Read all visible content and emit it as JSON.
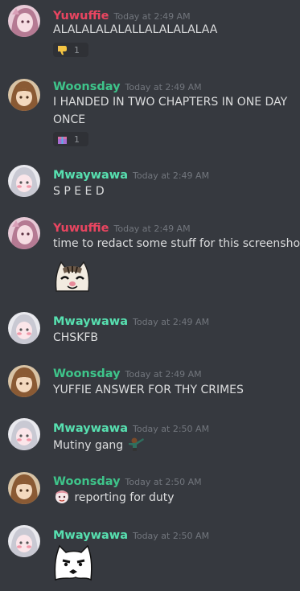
{
  "colors": {
    "background": "#36393f",
    "timestamp": "#72767d",
    "text": "#dcddde",
    "yuwuffie": "#e94560",
    "woonsday": "#3ec48a",
    "mwaywawa": "#57e0b0"
  },
  "messages": [
    {
      "author": "Yuwuffie",
      "timestamp": "Today at 2:49 AM",
      "lines": [
        "ALALALALALALLALALALALAA"
      ],
      "reaction": {
        "icon": "thumbs-down-icon",
        "count": "1"
      }
    },
    {
      "author": "Woonsday",
      "timestamp": "Today at 2:49 AM",
      "lines": [
        "I HANDED IN TWO CHAPTERS IN ONE DAY",
        "ONCE"
      ],
      "reaction": {
        "icon": "gift-icon",
        "count": "1"
      }
    },
    {
      "author": "Mwaywawa",
      "timestamp": "Today at 2:49 AM",
      "lines": [
        "S P E E D"
      ]
    },
    {
      "author": "Yuwuffie",
      "timestamp": "Today at 2:49 AM",
      "lines": [
        "time to redact some stuff for this screenshot"
      ],
      "attachment": "cat-emoji"
    },
    {
      "author": "Mwaywawa",
      "timestamp": "Today at 2:49 AM",
      "lines": [
        "CHSKFB"
      ]
    },
    {
      "author": "Woonsday",
      "timestamp": "Today at 2:49 AM",
      "lines": [
        "YUFFIE ANSWER FOR THY CRIMES"
      ]
    },
    {
      "author": "Mwaywawa",
      "timestamp": "Today at 2:50 AM",
      "lines": [
        "Mutiny gang"
      ],
      "inline_emoji": "dab-emoji"
    },
    {
      "author": "Woonsday",
      "timestamp": "Today at 2:50 AM",
      "lines": [
        "reporting for duty"
      ],
      "inline_emoji": "salute-emoji"
    },
    {
      "author": "Mwaywawa",
      "timestamp": "Today at 2:50 AM",
      "lines": [],
      "attachment": "ghost-cat-emoji"
    }
  ]
}
